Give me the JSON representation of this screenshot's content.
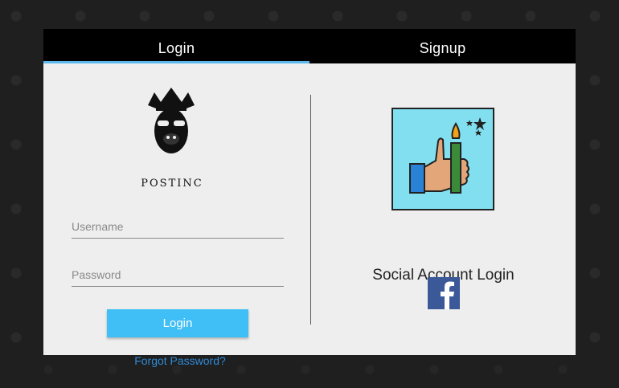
{
  "tabs": [
    {
      "label": "Login",
      "active": true
    },
    {
      "label": "Signup",
      "active": false
    }
  ],
  "brand": {
    "name": "POSTINC"
  },
  "form": {
    "username_placeholder": "Username",
    "password_placeholder": "Password",
    "login_label": "Login",
    "forgot_label": "Forgot Password?"
  },
  "social": {
    "title": "Social Account Login",
    "providers": [
      "facebook-icon"
    ]
  },
  "colors": {
    "accent": "#3fbff5",
    "tab_underline": "#5bb8ea",
    "link": "#2e8ad6",
    "facebook": "#3b5998"
  }
}
